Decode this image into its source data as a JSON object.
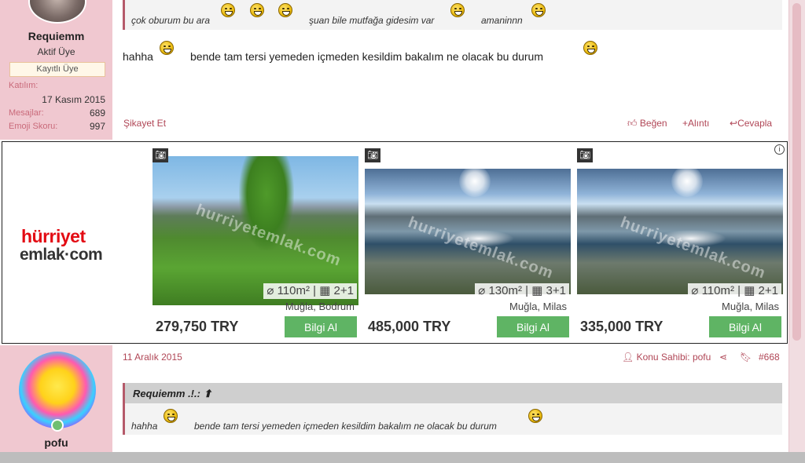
{
  "post1": {
    "user": {
      "name": "Requiemm",
      "title": "Aktif Üye",
      "badge": "Kayıtlı Üye"
    },
    "stats": [
      {
        "label": "Katılım:",
        "value": "17 Kasım 2015"
      },
      {
        "label": "Mesajlar:",
        "value": "689"
      },
      {
        "label": "Emoji Skoru:",
        "value": "997"
      }
    ],
    "quote": {
      "t1": "çok oburum bu ara",
      "t2": "şuan bile mutfağa gidesim var",
      "t3": "amaninnn"
    },
    "body": {
      "t1": "hahha",
      "t2": "bende tam tersi yemeden içmeden kesildim bakalım ne olacak bu durum"
    },
    "report": "Şikayet Et",
    "actions": {
      "like": "Beğen",
      "quote": "Alıntı",
      "reply": "Cevapla"
    }
  },
  "ad": {
    "logo_line1": "hürriyet",
    "logo_line2": "emlak·com",
    "watermark": "hurriyetemlak.com",
    "cards": [
      {
        "area": "110m²",
        "rooms": "2+1",
        "location": "Muğla, Bodrum",
        "price": "279,750 TRY",
        "button": "Bilgi Al"
      },
      {
        "area": "130m²",
        "rooms": "3+1",
        "location": "Muğla, Milas",
        "price": "485,000 TRY",
        "button": "Bilgi Al"
      },
      {
        "area": "110m²",
        "rooms": "2+1",
        "location": "Muğla, Milas",
        "price": "335,000 TRY",
        "button": "Bilgi Al"
      }
    ]
  },
  "post2": {
    "user": {
      "name": "pofu"
    },
    "date": "11 Aralık 2015",
    "owner": "Konu Sahibi: pofu",
    "number": "#668",
    "quote_author": "Requiemm .!.:",
    "quote": {
      "t1": "hahha",
      "t2": "bende tam tersi yemeden içmeden kesildim bakalım ne olacak bu durum"
    }
  },
  "colors": {
    "accent": "#b04656",
    "sidebar": "#f0c8d0",
    "button_green": "#5fb464"
  }
}
